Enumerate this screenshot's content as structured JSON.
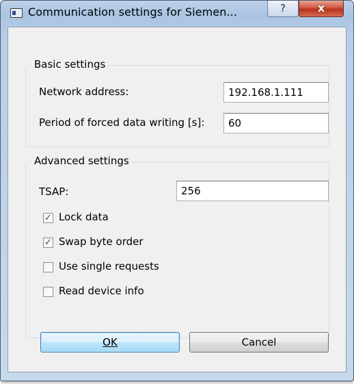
{
  "window": {
    "title": "Communication settings for Siemen...",
    "help_glyph": "?",
    "close_glyph": "x"
  },
  "basic": {
    "title": "Basic settings",
    "network_address_label": "Network address:",
    "network_address_value": "192.168.1.111",
    "period_label": "Period of forced data writing [s]:",
    "period_value": "60"
  },
  "advanced": {
    "title": "Advanced settings",
    "tsap_label": "TSAP:",
    "tsap_value": "256",
    "checkboxes": [
      {
        "label": "Lock data",
        "checked": true
      },
      {
        "label": "Swap byte order",
        "checked": true
      },
      {
        "label": "Use single requests",
        "checked": false
      },
      {
        "label": "Read device info",
        "checked": false
      }
    ],
    "check_glyph": "✓"
  },
  "buttons": {
    "ok_label": "OK",
    "cancel_label": "Cancel"
  },
  "colors": {
    "title_bar": "#b9cfe8",
    "close_button": "#c8452c",
    "ok_button": "#bee6fd"
  }
}
